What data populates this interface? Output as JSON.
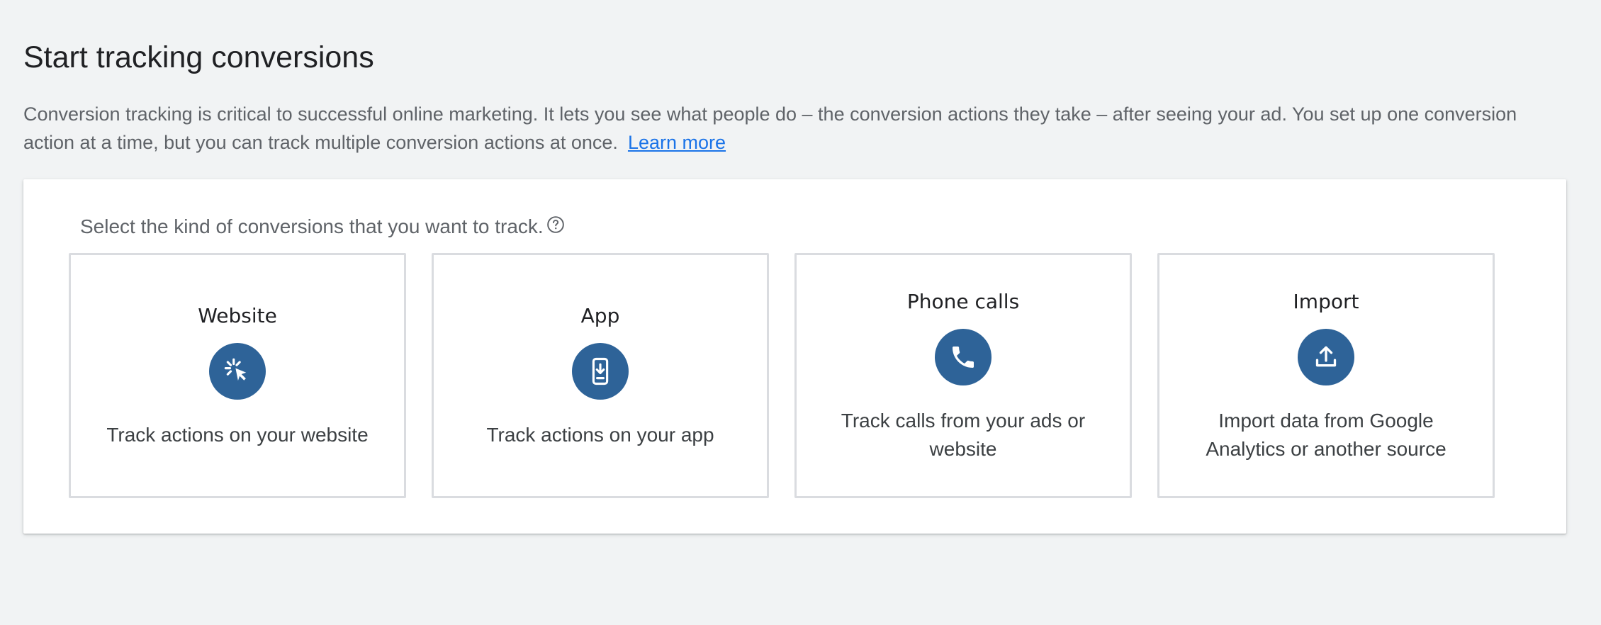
{
  "page": {
    "title": "Start tracking conversions",
    "intro": "Conversion tracking is critical to successful online marketing. It lets you see what people do – the conversion actions they take – after seeing your ad. You set up one conversion action at a time, but you can track multiple conversion actions at once.",
    "learn_more": "Learn more"
  },
  "selector": {
    "prompt": "Select the kind of conversions that you want to track.",
    "help_icon": "help-circle-icon",
    "options": [
      {
        "title": "Website",
        "icon": "cursor-click-icon",
        "description": "Track actions on your website"
      },
      {
        "title": "App",
        "icon": "mobile-download-icon",
        "description": "Track actions on your app"
      },
      {
        "title": "Phone calls",
        "icon": "phone-icon",
        "description": "Track calls from your ads or website"
      },
      {
        "title": "Import",
        "icon": "upload-icon",
        "description": "Import data from Google Analytics or another source"
      }
    ]
  },
  "colors": {
    "background": "#f1f3f4",
    "card": "#ffffff",
    "icon_circle": "#2e6398",
    "link": "#1a73e8",
    "option_border": "#dadce0"
  }
}
